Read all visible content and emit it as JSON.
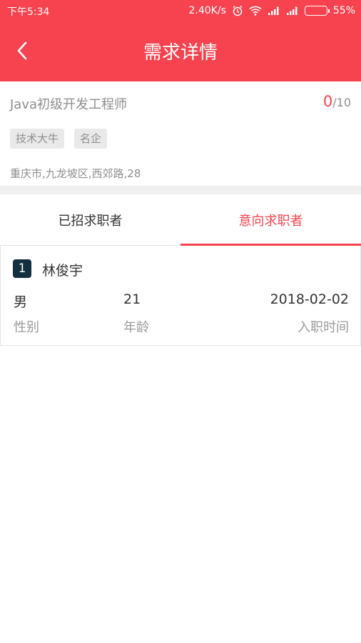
{
  "status_bar": {
    "time": "下午5:34",
    "network_speed": "2.40K/s",
    "battery": "55%",
    "battery_level": 0.55,
    "icons": [
      "alarm-icon",
      "wifi-icon",
      "signal-icon",
      "signal-icon",
      "battery-icon"
    ]
  },
  "header": {
    "title": "需求详情",
    "back_icon": "back-arrow-icon",
    "color": "#f6434f"
  },
  "job": {
    "title": "Java初级开发工程师",
    "count_current": "0",
    "count_total": "/10",
    "tags": [
      "技术大牛",
      "名企"
    ],
    "address": "重庆市,九龙坡区,西郊路,28"
  },
  "tabs": [
    {
      "label": "已招求职者",
      "active": false
    },
    {
      "label": "意向求职者",
      "active": true
    }
  ],
  "candidate": {
    "rank": "1",
    "name": "林俊宇",
    "gender_value": "男",
    "gender_label": "性别",
    "age_value": "21",
    "age_label": "年龄",
    "date_value": "2018-02-02",
    "date_label": "入职时间"
  }
}
